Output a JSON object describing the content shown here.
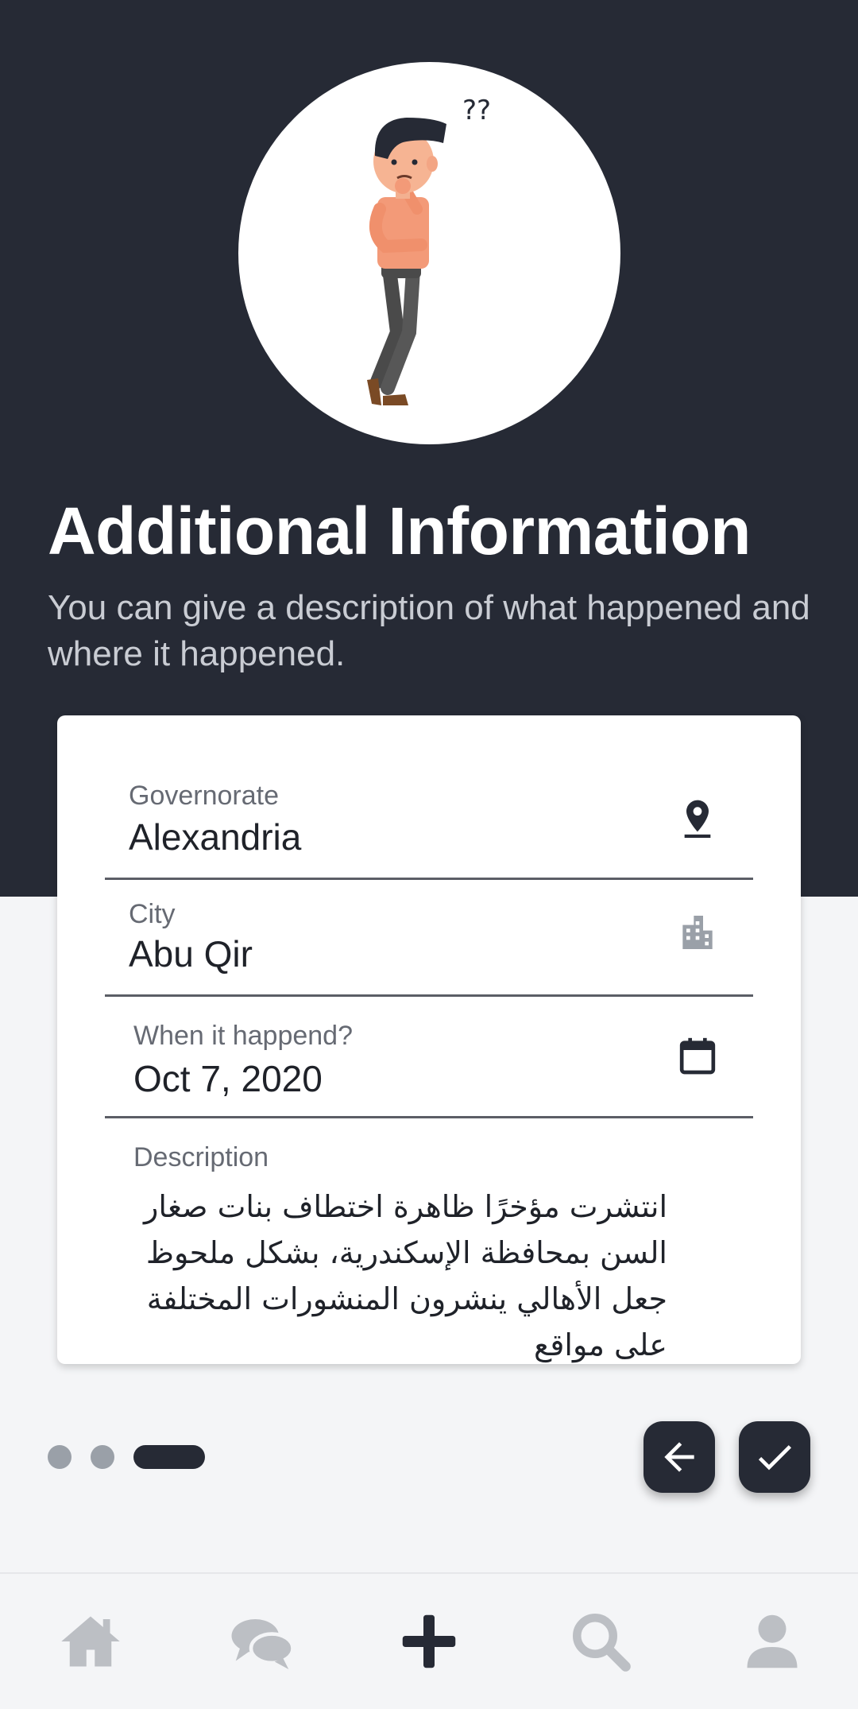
{
  "header": {
    "title": "Additional Information",
    "subtitle": "You can give a description of what happened and where it happened."
  },
  "illustration": {
    "question_marks": "??"
  },
  "form": {
    "governorate": {
      "label": "Governorate",
      "value": "Alexandria",
      "icon": "location-pin-icon"
    },
    "city": {
      "label": "City",
      "value": "Abu Qir",
      "icon": "city-buildings-icon"
    },
    "date": {
      "label": "When it happend?",
      "value": "Oct 7, 2020",
      "icon": "calendar-icon"
    },
    "description": {
      "label": "Description",
      "value": "انتشرت مؤخرًا ظاهرة اختطاف بنات صغار السن بمحافظة الإسكندرية، بشكل ملحوظ جعل الأهالي ينشرون المنشورات المختلفة على مواقع"
    }
  },
  "stepper": {
    "total_steps": 3,
    "current_step": 3
  },
  "buttons": {
    "back_icon": "arrow-left-icon",
    "done_icon": "check-icon"
  },
  "bottom_nav": {
    "items": [
      {
        "name": "home",
        "icon": "home-icon",
        "active": false
      },
      {
        "name": "chat",
        "icon": "chat-bubbles-icon",
        "active": false
      },
      {
        "name": "add",
        "icon": "plus-icon",
        "active": true
      },
      {
        "name": "search",
        "icon": "search-icon",
        "active": false
      },
      {
        "name": "profile",
        "icon": "user-icon",
        "active": false
      }
    ]
  },
  "colors": {
    "dark": "#262a35",
    "background": "#f4f5f7",
    "inactive_icon": "#bcbfc4",
    "dot_inactive": "#9aa0a8"
  }
}
